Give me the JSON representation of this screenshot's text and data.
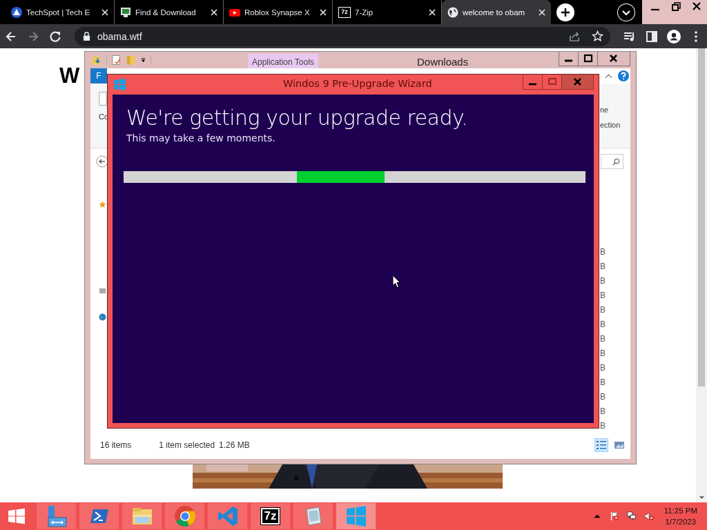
{
  "browser": {
    "tabs": [
      {
        "title": "TechSpot | Tech E",
        "kind": "techspot",
        "selected": false
      },
      {
        "title": "Find & Download",
        "kind": "monitor",
        "selected": false
      },
      {
        "title": "Roblox Synapse X",
        "kind": "youtube",
        "selected": false
      },
      {
        "title": "7-Zip",
        "kind": "sevenzip",
        "icon_text": "7z",
        "selected": false
      },
      {
        "title": "welcome to obam",
        "kind": "globe",
        "selected": true
      }
    ],
    "address": "obama.wtf"
  },
  "page": {
    "heading": "W"
  },
  "explorer": {
    "context_tab": "Application Tools",
    "title": "Downloads",
    "ribbon_tab": "F",
    "ribbon_label": "Co",
    "right_labels": [
      "ne",
      "ection"
    ],
    "size_column": [
      "B",
      "B",
      "B",
      "B",
      "B",
      "B",
      "B",
      "B",
      "B",
      "B",
      "B",
      "B",
      "B"
    ],
    "status": {
      "items": "16 items",
      "selection": "1 item selected",
      "size": "1.26 MB"
    },
    "views": [
      {
        "kind": "details",
        "selected": true
      },
      {
        "kind": "tiles",
        "selected": false
      }
    ]
  },
  "wizard": {
    "title": "Windos 9 Pre-Upgrade Wizard",
    "heading": "We're getting your upgrade ready.",
    "subtitle": "This may take a few moments.",
    "progress": {
      "indeterminate": true
    }
  },
  "taskbar": {
    "apps": [
      {
        "kind": "server",
        "active": false
      },
      {
        "kind": "powershell",
        "active": false
      },
      {
        "kind": "folder",
        "active": false
      },
      {
        "kind": "chrome",
        "active": false
      },
      {
        "kind": "vscode",
        "active": false
      },
      {
        "kind": "sevenzip",
        "label": "7z",
        "active": false
      },
      {
        "kind": "notepad",
        "active": false
      },
      {
        "kind": "windows",
        "active": true
      }
    ],
    "volume_muted": true,
    "clock": {
      "time": "11:25 PM",
      "date": "1/7/2023"
    }
  }
}
